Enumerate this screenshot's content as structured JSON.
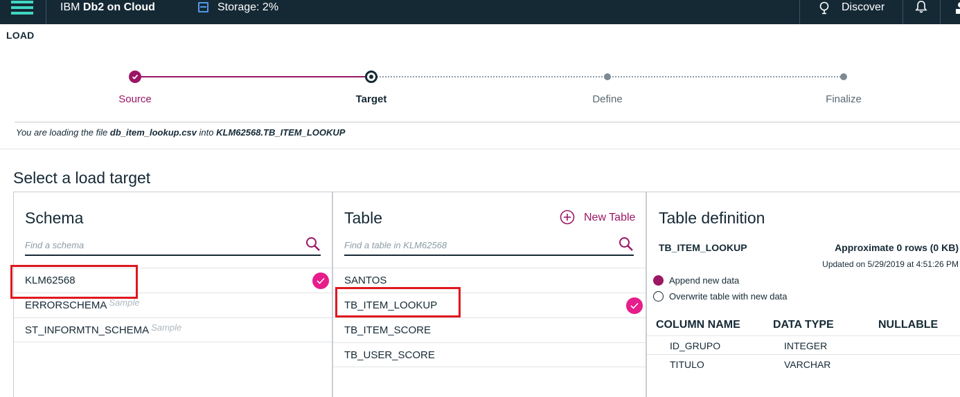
{
  "topbar": {
    "brand_prefix": "IBM",
    "brand_name": "Db2 on Cloud",
    "storage": "Storage: 2%",
    "discover": "Discover"
  },
  "page": {
    "title": "LOAD"
  },
  "stepper": {
    "steps": [
      {
        "label": "Source",
        "state": "complete"
      },
      {
        "label": "Target",
        "state": "current"
      },
      {
        "label": "Define",
        "state": "pending"
      },
      {
        "label": "Finalize",
        "state": "pending"
      }
    ]
  },
  "loading_info": {
    "prefix": "You are loading the file",
    "file": "db_item_lookup.csv",
    "middle": "into",
    "target": "KLM62568.TB_ITEM_LOOKUP"
  },
  "select_title": "Select a load target",
  "schema_panel": {
    "title": "Schema",
    "search_placeholder": "Find a schema",
    "items": [
      {
        "name": "KLM62568",
        "tag": "",
        "selected": true
      },
      {
        "name": "ERRORSCHEMA",
        "tag": "Sample",
        "selected": false
      },
      {
        "name": "ST_INFORMTN_SCHEMA",
        "tag": "Sample",
        "selected": false
      }
    ]
  },
  "table_panel": {
    "title": "Table",
    "new_table": "New Table",
    "search_placeholder": "Find a table in KLM62568",
    "items": [
      {
        "name": "SANTOS",
        "selected": false
      },
      {
        "name": "TB_ITEM_LOOKUP",
        "selected": true
      },
      {
        "name": "TB_ITEM_SCORE",
        "selected": false
      },
      {
        "name": "TB_USER_SCORE",
        "selected": false
      }
    ]
  },
  "definition_panel": {
    "title": "Table definition",
    "table_name": "TB_ITEM_LOOKUP",
    "rows": "Approximate 0 rows (0 KB)",
    "updated": "Updated on 5/29/2019 at 4:51:26 PM",
    "options": [
      {
        "label": "Append new data",
        "selected": true
      },
      {
        "label": "Overwrite table with new data",
        "selected": false
      }
    ],
    "headers": [
      "COLUMN NAME",
      "DATA TYPE",
      "NULLABLE"
    ],
    "columns": [
      {
        "name": "ID_GRUPO",
        "type": "INTEGER",
        "nullable": ""
      },
      {
        "name": "TITULO",
        "type": "VARCHAR",
        "nullable": ""
      }
    ]
  },
  "colors": {
    "topbar": "#152935",
    "accent": "#9b1664",
    "check": "#e71d8c",
    "highlight": "#e0171e"
  }
}
